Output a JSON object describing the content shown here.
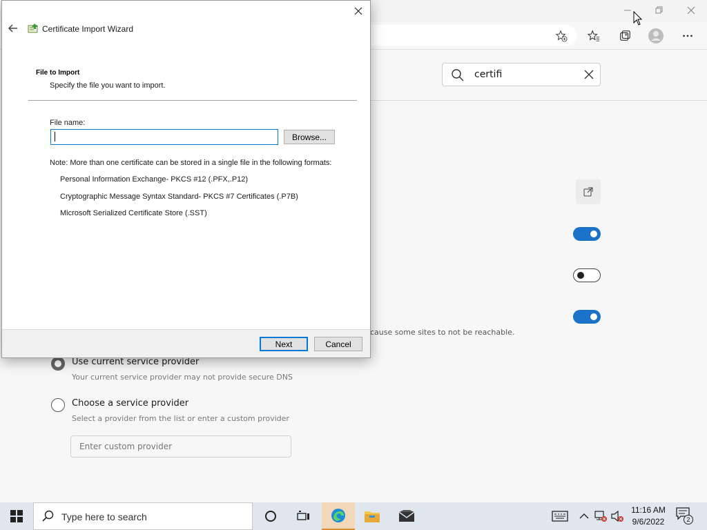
{
  "browser": {
    "settings_search": {
      "value": "certifi"
    },
    "dns_note": "cause some sites to not be reachable.",
    "dns_options": [
      {
        "label": "Use current service provider",
        "sub": "Your current service provider may not provide secure DNS",
        "checked": true
      },
      {
        "label": "Choose a service provider",
        "sub": "Select a provider from the list or enter a custom provider",
        "checked": false
      }
    ],
    "custom_provider_placeholder": "Enter custom provider",
    "toggles": [
      true,
      false,
      true
    ]
  },
  "wizard": {
    "title": "Certificate Import Wizard",
    "page_title": "File to Import",
    "page_subtitle": "Specify the file you want to import.",
    "file_label": "File name:",
    "file_value": "",
    "browse_label": "Browse...",
    "note": "Note:  More than one certificate can be stored in a single file in the following formats:",
    "formats": [
      "Personal Information Exchange- PKCS #12 (.PFX,.P12)",
      "Cryptographic Message Syntax Standard- PKCS #7 Certificates (.P7B)",
      "Microsoft Serialized Certificate Store (.SST)"
    ],
    "next_label": "Next",
    "cancel_label": "Cancel"
  },
  "taskbar": {
    "search_placeholder": "Type here to search",
    "time": "11:16 AM",
    "date": "9/6/2022",
    "notification_count": "2"
  },
  "colors": {
    "accent": "#0078d7",
    "toggle_on": "#1a73c8",
    "taskbar_bg": "#dfe6ee",
    "active_task": "#f2d8b8"
  }
}
